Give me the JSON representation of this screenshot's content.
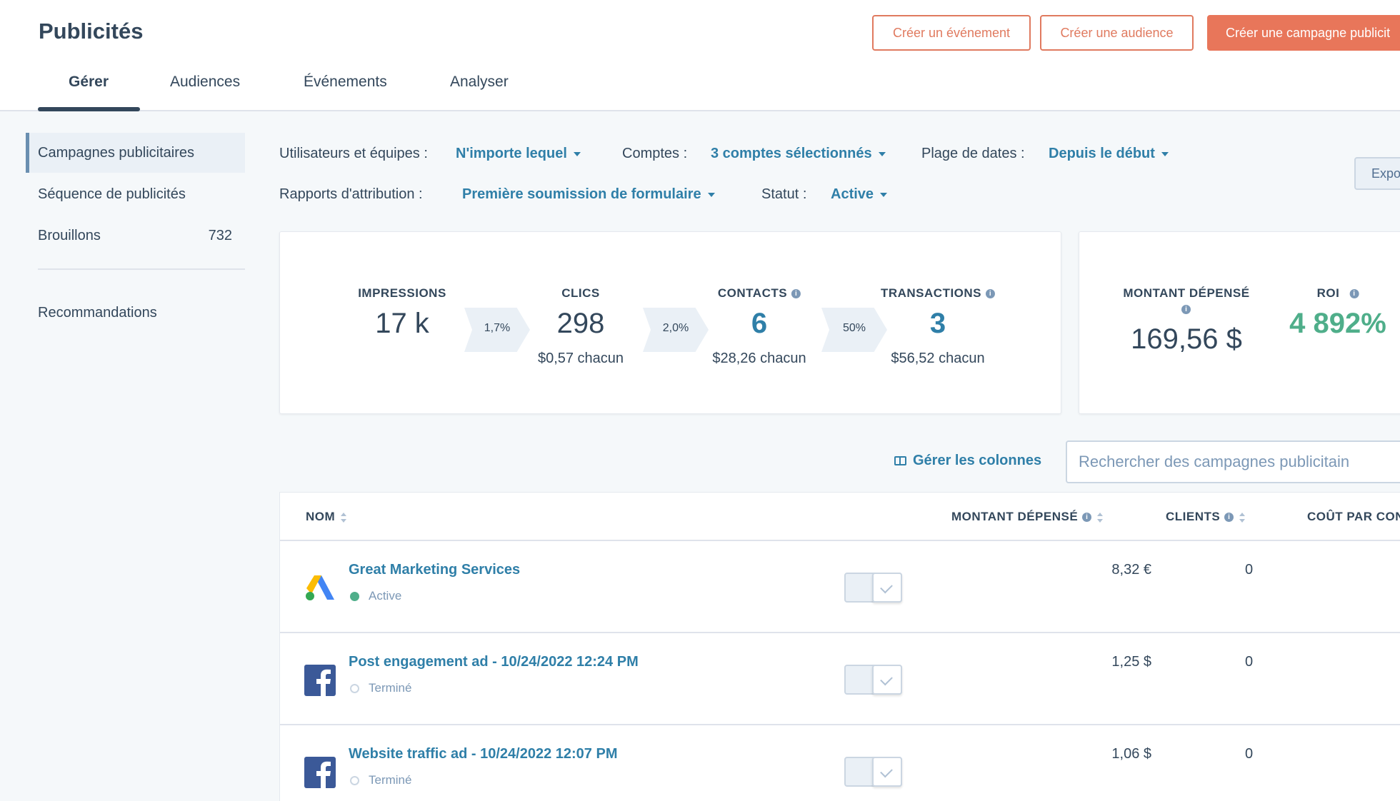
{
  "header": {
    "title": "Publicités",
    "buttons": {
      "create_event": "Créer un événement",
      "create_audience": "Créer une audience",
      "create_campaign": "Créer une campagne publicit"
    },
    "tabs": [
      "Gérer",
      "Audiences",
      "Événements",
      "Analyser"
    ],
    "active_tab": "Gérer"
  },
  "sidebar": {
    "items": [
      {
        "label": "Campagnes publicitaires",
        "active": true
      },
      {
        "label": "Séquence de publicités"
      },
      {
        "label": "Brouillons",
        "count": "732"
      },
      {
        "label": "Recommandations"
      }
    ]
  },
  "filters": {
    "users_label": "Utilisateurs et équipes :",
    "users_value": "N'importe lequel",
    "accounts_label": "Comptes :",
    "accounts_value": "3 comptes sélectionnés",
    "dates_label": "Plage de dates :",
    "dates_value": "Depuis le début",
    "attribution_label": "Rapports d'attribution :",
    "attribution_value": "Première soumission de formulaire",
    "status_label": "Statut :",
    "status_value": "Active",
    "export_label": "Expo"
  },
  "kpis": {
    "impressions": {
      "label": "IMPRESSIONS",
      "value": "17 k"
    },
    "rate1": "1,7%",
    "clicks": {
      "label": "CLICS",
      "value": "298",
      "sub": "$0,57 chacun"
    },
    "rate2": "2,0%",
    "contacts": {
      "label": "CONTACTS",
      "value": "6",
      "sub": "$28,26 chacun"
    },
    "rate3": "50%",
    "transactions": {
      "label": "TRANSACTIONS",
      "value": "3",
      "sub": "$56,52 chacun"
    },
    "spent": {
      "label": "MONTANT DÉPENSÉ",
      "value": "169,56 $"
    },
    "roi": {
      "label": "ROI",
      "value": "4 892%"
    }
  },
  "toolbar": {
    "manage_columns": "Gérer les colonnes",
    "search_placeholder": "Rechercher des campagnes publicitain"
  },
  "table": {
    "headers": {
      "name": "NOM",
      "spent": "MONTANT DÉPENSÉ",
      "clients": "CLIENTS",
      "cost": "COÛT PAR CON"
    },
    "rows": [
      {
        "name": "Great Marketing Services",
        "status": "Active",
        "platform": "google-ads-icon",
        "spent": "8,32 €",
        "clients": "0"
      },
      {
        "name": "Post engagement ad - 10/24/2022 12:24 PM",
        "status": "Terminé",
        "platform": "facebook-icon",
        "spent": "1,25 $",
        "clients": "0"
      },
      {
        "name": "Website traffic ad - 10/24/2022 12:07 PM",
        "status": "Terminé",
        "platform": "facebook-icon",
        "spent": "1,06 $",
        "clients": "0"
      }
    ]
  },
  "colors": {
    "accent": "#e8765a",
    "link": "#2f7fa8",
    "success": "#4fae8a",
    "text": "#33475b"
  }
}
